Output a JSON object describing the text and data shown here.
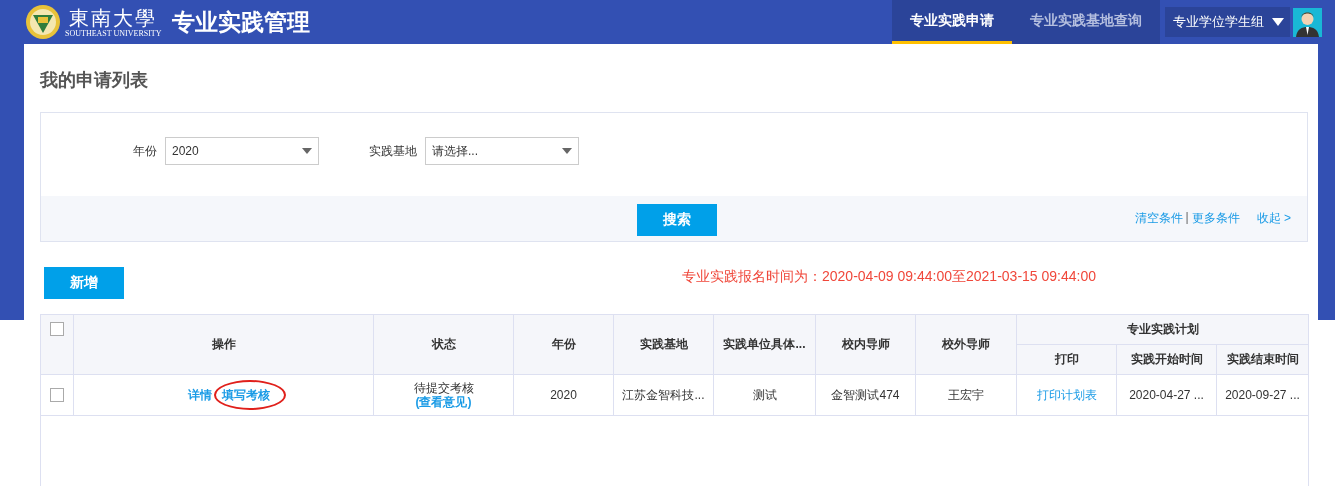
{
  "header": {
    "logo_cn": "東南大學",
    "logo_en": "SOUTHEAST UNIVERSITY",
    "app_title": "专业实践管理",
    "tabs": [
      {
        "label": "专业实践申请",
        "selected": true
      },
      {
        "label": "专业实践基地查询",
        "selected": false
      }
    ],
    "user_group": "专业学位学生组"
  },
  "page_title": "我的申请列表",
  "filters": [
    {
      "label": "年份",
      "value": "2020"
    },
    {
      "label": "实践基地",
      "placeholder": "请选择..."
    }
  ],
  "search_button": "搜索",
  "filter_links": [
    "清空条件",
    "更多条件"
  ],
  "filter_separator": "|",
  "collapse_link": "收起 >",
  "add_button": "新增",
  "notice": "专业实践报名时间为：2020-04-09 09:44:00至2021-03-15 09:44:00",
  "table": {
    "all_checked": false,
    "columns": [
      "操作",
      "状态",
      "年份",
      "实践基地",
      "实践单位具体...",
      "校内导师",
      "校外导师"
    ],
    "group_column": "专业实践计划",
    "group_subcolumns": [
      "打印",
      "实践开始时间",
      "实践结束时间"
    ],
    "rows": [
      {
        "checked": false,
        "actions": [
          {
            "label": "详情",
            "circled": false
          },
          {
            "label": "填写考核",
            "circled": true
          }
        ],
        "status": "待提交考核",
        "status_link": "(查看意见)",
        "year": "2020",
        "base": "江苏金智科技...",
        "unit": "测试",
        "inner_tutor": "金智测试474",
        "outer_tutor": "王宏宇",
        "print_link": "打印计划表",
        "start": "2020-04-27 ...",
        "end": "2020-09-27 ..."
      }
    ]
  }
}
